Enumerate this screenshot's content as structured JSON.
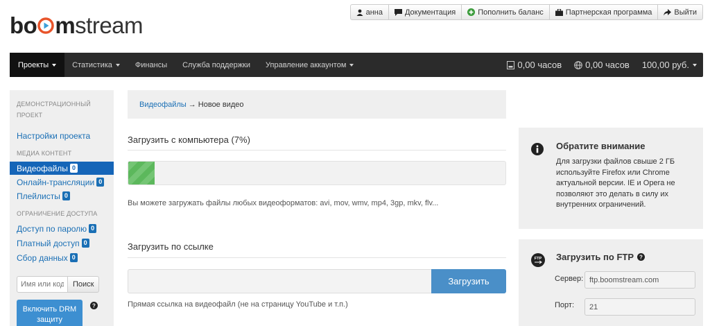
{
  "userbar": {
    "user": "анна",
    "docs": "Документация",
    "topup": "Пополнить баланс",
    "partner": "Партнерская программа",
    "logout": "Выйти"
  },
  "logo": {
    "part1": "bo",
    "part2": "m",
    "part3": "stream"
  },
  "nav": {
    "projects": "Проекты",
    "stats": "Статистика",
    "finance": "Финансы",
    "support": "Служба поддержки",
    "account": "Управление аккаунтом",
    "hours1": "0,00 часов",
    "hours2": "0,00 часов",
    "balance": "100,00 руб."
  },
  "sidebar": {
    "project_head": "Демонстрационный проект",
    "project_settings": "Настройки проекта",
    "media_head": "Медиа контент",
    "videos": "Видеофайлы",
    "videos_count": "0",
    "live": "Онлайн-трансляции",
    "live_count": "0",
    "playlists": "Плейлисты",
    "playlists_count": "0",
    "access_head": "Ограничение доступа",
    "password_access": "Доступ по паролю",
    "password_count": "0",
    "paid_access": "Платный доступ",
    "paid_count": "0",
    "data_collect": "Сбор данных",
    "data_count": "0",
    "search_placeholder": "Имя или код",
    "search_btn": "Поиск",
    "drm_btn": "Включить DRM защиту"
  },
  "breadcrumb": {
    "link": "Видеофайлы",
    "arrow": "→",
    "current": "Новое видео"
  },
  "upload": {
    "title": "Загрузить с компьютера (7%)",
    "progress": 7,
    "hint": "Вы можете загружать файлы любых видеоформатов: avi, mov, wmv, mp4, 3gp, mkv, flv..."
  },
  "link_upload": {
    "title": "Загрузить по ссылке",
    "button": "Загрузить",
    "hint": "Прямая ссылка на видеофайл (не на страницу YouTube и т.п.)"
  },
  "notice": {
    "title": "Обратите внимание",
    "text": "Для загрузки файлов свыше 2 ГБ используйте Firefox или Chrome актуальной версии. IE и Opera не позволяют это делать в силу их внутренних ограничений."
  },
  "ftp": {
    "title": "Загрузить по FTP",
    "server_label": "Сервер:",
    "server_value": "ftp.boomstream.com",
    "port_label": "Порт:",
    "port_value": "21",
    "icon_text": "FTP"
  },
  "colors": {
    "accent": "#1565b8",
    "progress": "#5cb85c",
    "navbar": "#2b2b2b"
  }
}
